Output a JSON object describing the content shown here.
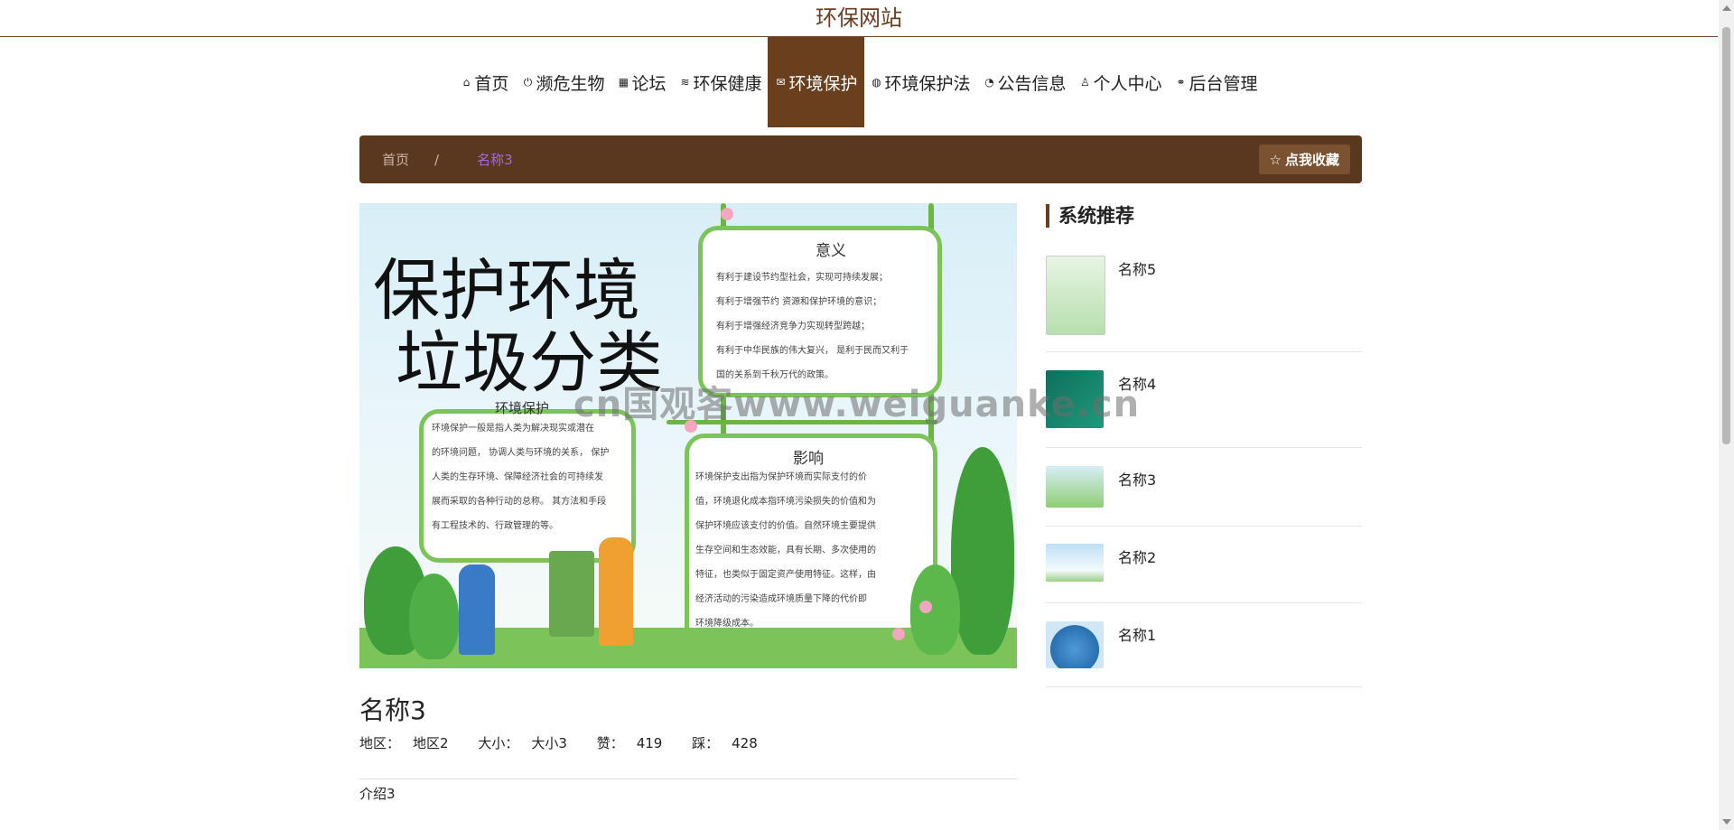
{
  "site": {
    "title": "环保网站"
  },
  "nav": {
    "items": [
      {
        "label": "首页",
        "icon": "home-icon",
        "glyph": "⌂"
      },
      {
        "label": "濒危生物",
        "icon": "power-icon",
        "glyph": "⏻"
      },
      {
        "label": "论坛",
        "icon": "grid-icon",
        "glyph": "▦"
      },
      {
        "label": "环保健康",
        "icon": "layers-icon",
        "glyph": "≋"
      },
      {
        "label": "环境保护",
        "icon": "mail-icon",
        "glyph": "✉",
        "active": true
      },
      {
        "label": "环境保护法",
        "icon": "globe-icon",
        "glyph": "◍"
      },
      {
        "label": "公告信息",
        "icon": "palette-icon",
        "glyph": "◔"
      },
      {
        "label": "个人中心",
        "icon": "user-icon",
        "glyph": "♙"
      },
      {
        "label": "后台管理",
        "icon": "link-icon",
        "glyph": "⚭"
      }
    ],
    "active_color": "#6a3f1e"
  },
  "breadcrumb": {
    "home": "首页",
    "separator": "/",
    "current": "名称3"
  },
  "favorite": {
    "label": "点我收藏",
    "icon": "star-icon",
    "glyph": "☆"
  },
  "poster": {
    "headline_1": "保护环境",
    "headline_2": "垃圾分类",
    "card_meaning_title": "意义",
    "card_meaning_lines": [
      "有利于建设节约型社会，实现可持续发展；",
      "有利于增强节约  资源和保护环境的意识；",
      "有利于增强经济竞争力实现转型跨越；",
      "有利于中华民族的伟大复兴，  是利于民而又利于",
      "国的关系到千秋万代的政策。"
    ],
    "card_protect_title": "环境保护",
    "card_protect_lines": [
      "环境保护一般是指人类为解决现实或潜在",
      "的环境问题，  协调人类与环境的关系，  保护",
      "人类的生存环境、保障经济社会的可持续发",
      "展而采取的各种行动的总称。  其方法和手段",
      "有工程技术的、行政管理的等。"
    ],
    "card_impact_title": "影响",
    "card_impact_lines": [
      "环境保护支出指为保护环境而实际支付的价",
      "值，环境退化成本指环境污染损失的价值和为",
      "保护环境应该支付的价值。自然环境主要提供",
      "生存空间和生态效能，具有长期、多次使用的",
      "特征，也类似于固定资产使用特征。这样，由",
      "经济活动的污染造成环境质量下降的代价即",
      "环境降级成本。"
    ]
  },
  "detail": {
    "title": "名称3",
    "region_label": "地区：",
    "region_value": "地区2",
    "size_label": "大小：",
    "size_value": "大小3",
    "like_label": "赞：",
    "like_value": "419",
    "dislike_label": "踩：",
    "dislike_value": "428",
    "intro": "介绍3"
  },
  "sidebar": {
    "title": "系统推荐",
    "items": [
      {
        "name": "名称5"
      },
      {
        "name": "名称4"
      },
      {
        "name": "名称3"
      },
      {
        "name": "名称2"
      },
      {
        "name": "名称1"
      }
    ]
  },
  "watermark": "cn国观客www.weiguanke.cn"
}
